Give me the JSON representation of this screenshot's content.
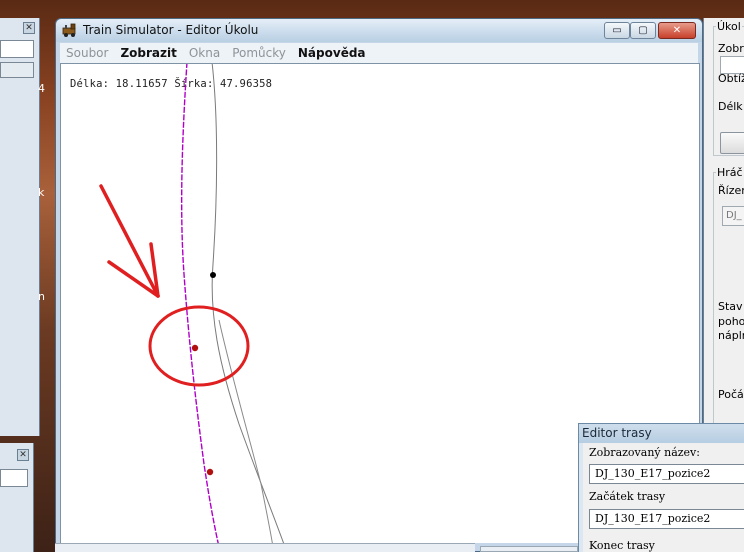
{
  "window": {
    "title": "Train Simulator - Editor Úkolu",
    "controls": {
      "minimize": "▭",
      "maximize": "▢",
      "close": "✕"
    }
  },
  "menu": {
    "items": [
      {
        "label": "Soubor",
        "enabled": false
      },
      {
        "label": "Zobrazit",
        "enabled": true
      },
      {
        "label": "Okna",
        "enabled": false
      },
      {
        "label": "Pomůcky",
        "enabled": false
      },
      {
        "label": "Nápověda",
        "enabled": true
      }
    ]
  },
  "canvas": {
    "coord_readout": "Délka: 18.11657 Šírka: 47.96358"
  },
  "right_panel": {
    "group1_label": "Úkol",
    "label_zobraz": "Zobraz",
    "label_obtiz": "Obtíž",
    "label_delka": "Délk",
    "group2_label": "Hráč",
    "label_rizeni": "Řízen",
    "combo_value": "DJ_",
    "label_stav": "Stav",
    "label_poho": "poho",
    "label_napln": "náplr",
    "label_poca": "Počá"
  },
  "editor_trasy": {
    "title": "Editor trasy",
    "display_name_label": "Zobrazovaný název:",
    "display_name_value": "DJ_130_E17_pozice2",
    "start_label": "Začátek trasy",
    "start_value": "DJ_130_E17_pozice2",
    "end_label": "Konec trasy"
  },
  "left_windows": {
    "glyph_1": "4",
    "glyph_2": "k",
    "glyph_3": "n",
    "close_icon": "✕"
  },
  "colors": {
    "track_purple": "#b000c8",
    "track_grey": "#7a7a7a",
    "annotation_red": "#e02020",
    "marker_dark_red": "#b01010",
    "marker_black": "#000000"
  }
}
